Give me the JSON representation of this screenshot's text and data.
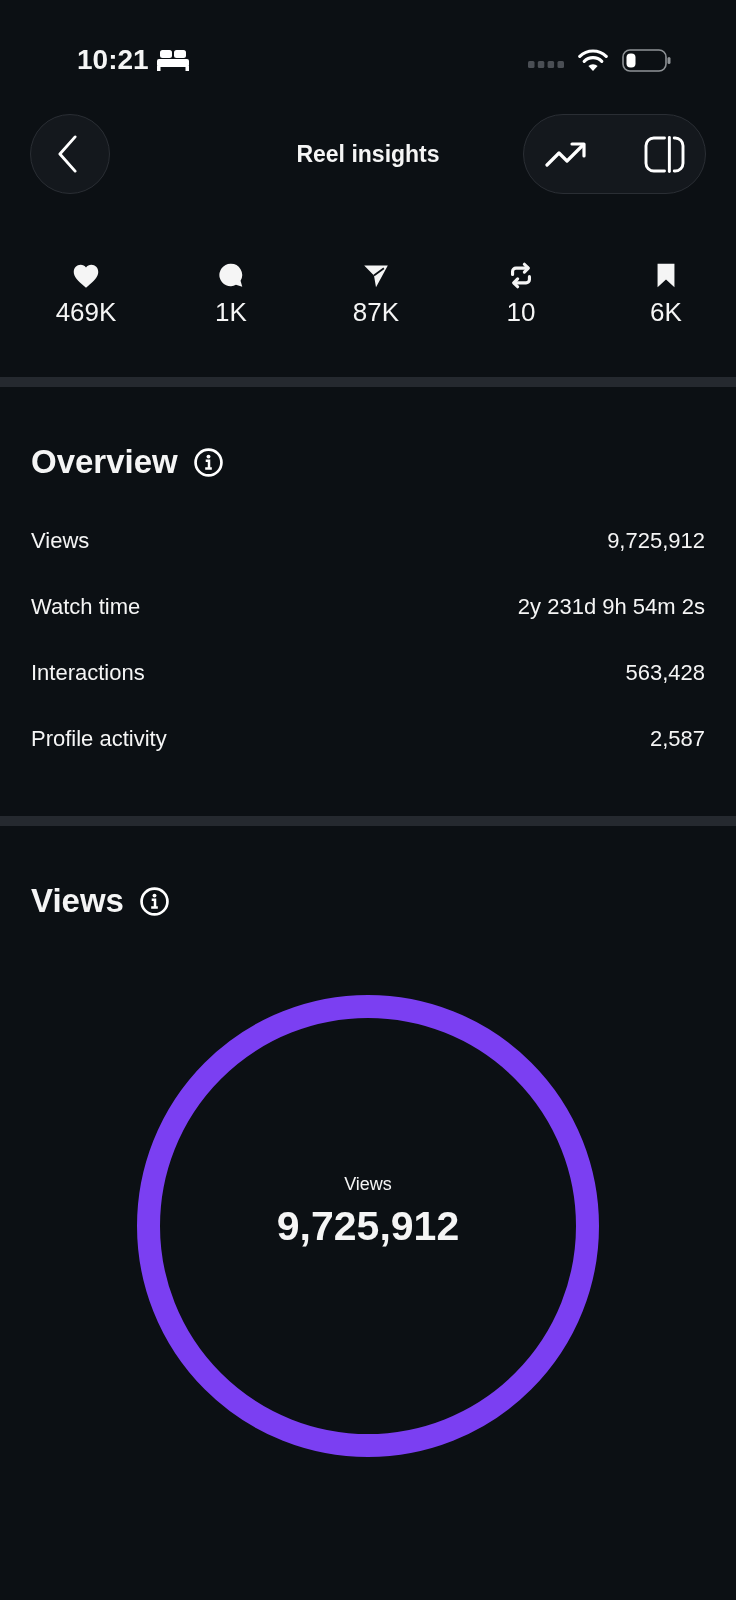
{
  "status_bar": {
    "time": "10:21"
  },
  "header": {
    "title": "Reel insights"
  },
  "engagement": [
    {
      "kind": "likes",
      "value": "469K"
    },
    {
      "kind": "comments",
      "value": "1K"
    },
    {
      "kind": "shares",
      "value": "87K"
    },
    {
      "kind": "reposts",
      "value": "10"
    },
    {
      "kind": "saves",
      "value": "6K"
    }
  ],
  "overview": {
    "title": "Overview",
    "rows": [
      {
        "label": "Views",
        "value": "9,725,912"
      },
      {
        "label": "Watch time",
        "value": "2y 231d 9h 54m 2s"
      },
      {
        "label": "Interactions",
        "value": "563,428"
      },
      {
        "label": "Profile activity",
        "value": "2,587"
      }
    ]
  },
  "views": {
    "title": "Views",
    "ring": {
      "label": "Views",
      "value": "9,725,912"
    }
  }
}
